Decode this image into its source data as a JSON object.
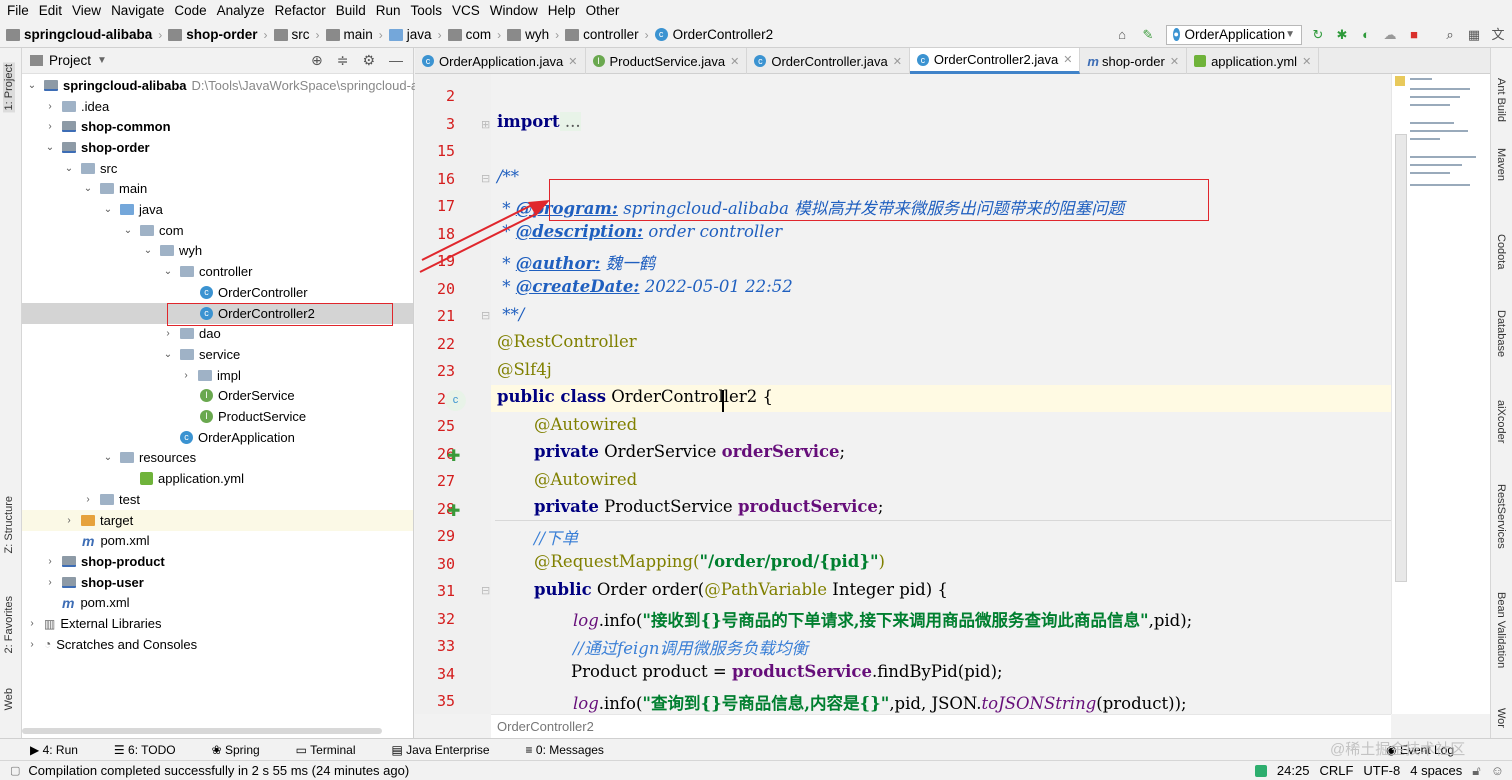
{
  "menu": [
    "File",
    "Edit",
    "View",
    "Navigate",
    "Code",
    "Analyze",
    "Refactor",
    "Build",
    "Run",
    "Tools",
    "VCS",
    "Window",
    "Help",
    "Other"
  ],
  "breadcrumb": [
    "springcloud-alibaba",
    "shop-order",
    "src",
    "main",
    "java",
    "com",
    "wyh",
    "controller",
    "OrderController2"
  ],
  "run_config": "OrderApplication",
  "project_panel": {
    "title": "Project"
  },
  "tree": [
    {
      "label": "springcloud-alibaba",
      "extra": "D:\\Tools\\JavaWorkSpace\\springcloud-al",
      "bold": true
    },
    {
      "label": ".idea"
    },
    {
      "label": "shop-common",
      "bold": true
    },
    {
      "label": "shop-order",
      "bold": true
    },
    {
      "label": "src"
    },
    {
      "label": "main"
    },
    {
      "label": "java"
    },
    {
      "label": "com"
    },
    {
      "label": "wyh"
    },
    {
      "label": "controller"
    },
    {
      "label": "OrderController"
    },
    {
      "label": "OrderController2"
    },
    {
      "label": "dao"
    },
    {
      "label": "service"
    },
    {
      "label": "impl"
    },
    {
      "label": "OrderService"
    },
    {
      "label": "ProductService"
    },
    {
      "label": "OrderApplication"
    },
    {
      "label": "resources"
    },
    {
      "label": "application.yml"
    },
    {
      "label": "test"
    },
    {
      "label": "target"
    },
    {
      "label": "pom.xml"
    },
    {
      "label": "shop-product",
      "bold": true
    },
    {
      "label": "shop-user",
      "bold": true
    },
    {
      "label": "pom.xml"
    },
    {
      "label": "External Libraries"
    },
    {
      "label": "Scratches and Consoles"
    }
  ],
  "editor_tabs": [
    "OrderApplication.java",
    "ProductService.java",
    "OrderController.java",
    "OrderController2.java",
    "shop-order",
    "application.yml"
  ],
  "line_numbers": [
    "2",
    "3",
    "15",
    "16",
    "17",
    "18",
    "19",
    "20",
    "21",
    "22",
    "23",
    "24",
    "25",
    "26",
    "27",
    "28",
    "29",
    "30",
    "31",
    "32",
    "33",
    "34",
    "35"
  ],
  "code": {
    "l3_kw": "import",
    "l3_rest": " ...",
    "l16": "/**",
    "l17_tag": "@program:",
    "l17_text": " springcloud-alibaba 模拟高并发带来微服务出问题带来的阻塞问题",
    "l18_tag": "@description:",
    "l18_text": " order controller",
    "l19_tag": "@author:",
    "l19_text": " 魏一鹤",
    "l20_tag": "@createDate:",
    "l20_text": " 2022-05-01 22:52",
    "l21": "**/",
    "l22": "@RestController",
    "l23": "@Slf4j",
    "l24_kw": "public class",
    "l24_rest": " OrderController2 {",
    "l25": "@Autowired",
    "l26_kw": "private",
    "l26_type": " OrderService ",
    "l26_field": "orderService",
    "l27": "@Autowired",
    "l28_kw": "private",
    "l28_type": " ProductService ",
    "l28_field": "productService",
    "l29": "//下单",
    "l30_ann": "@RequestMapping(",
    "l30_str": "\"/order/prod/{pid}\"",
    "l31_kw": "public",
    "l31_a": " Order order(",
    "l31_ann": "@PathVariable",
    "l31_b": " Integer pid) {",
    "l32_log": "log",
    "l32_a": ".info(",
    "l32_str": "\"接收到{}号商品的下单请求,接下来调用商品微服务查询此商品信息\"",
    "l32_b": ",pid);",
    "l33": "//通过feign调用微服务负载均衡",
    "l34_a": "Product product = ",
    "l34_field": "productService",
    "l34_b": ".findByPid(pid);",
    "l35_log": "log",
    "l35_a": ".info(",
    "l35_str": "\"查询到{}号商品信息,内容是{}\"",
    "l35_b": ",pid, JSON.",
    "l35_m": "toJSONString",
    "l35_c": "(product));"
  },
  "editor_breadcrumb": "OrderController2",
  "left_tabs": [
    "1: Project",
    "Z: Structure",
    "2: Favorites",
    "Web"
  ],
  "right_tabs": [
    "Ant Build",
    "Maven",
    "Codota",
    "Database",
    "aiXcoder",
    "RestServices",
    "Bean Validation",
    "Wor"
  ],
  "tool_windows": [
    "4: Run",
    "6: TODO",
    "Spring",
    "Terminal",
    "Java Enterprise",
    "0: Messages"
  ],
  "event_log": "Event Log",
  "status": {
    "message": "Compilation completed successfully in 2 s 55 ms (24 minutes ago)",
    "position": "24:25",
    "line_sep": "CRLF",
    "encoding": "UTF-8",
    "indent": "4 spaces"
  },
  "watermark": "@稀土掘金技术社区",
  "colors": {
    "highlight_box": "#e0262c",
    "accent": "#4083c9"
  }
}
